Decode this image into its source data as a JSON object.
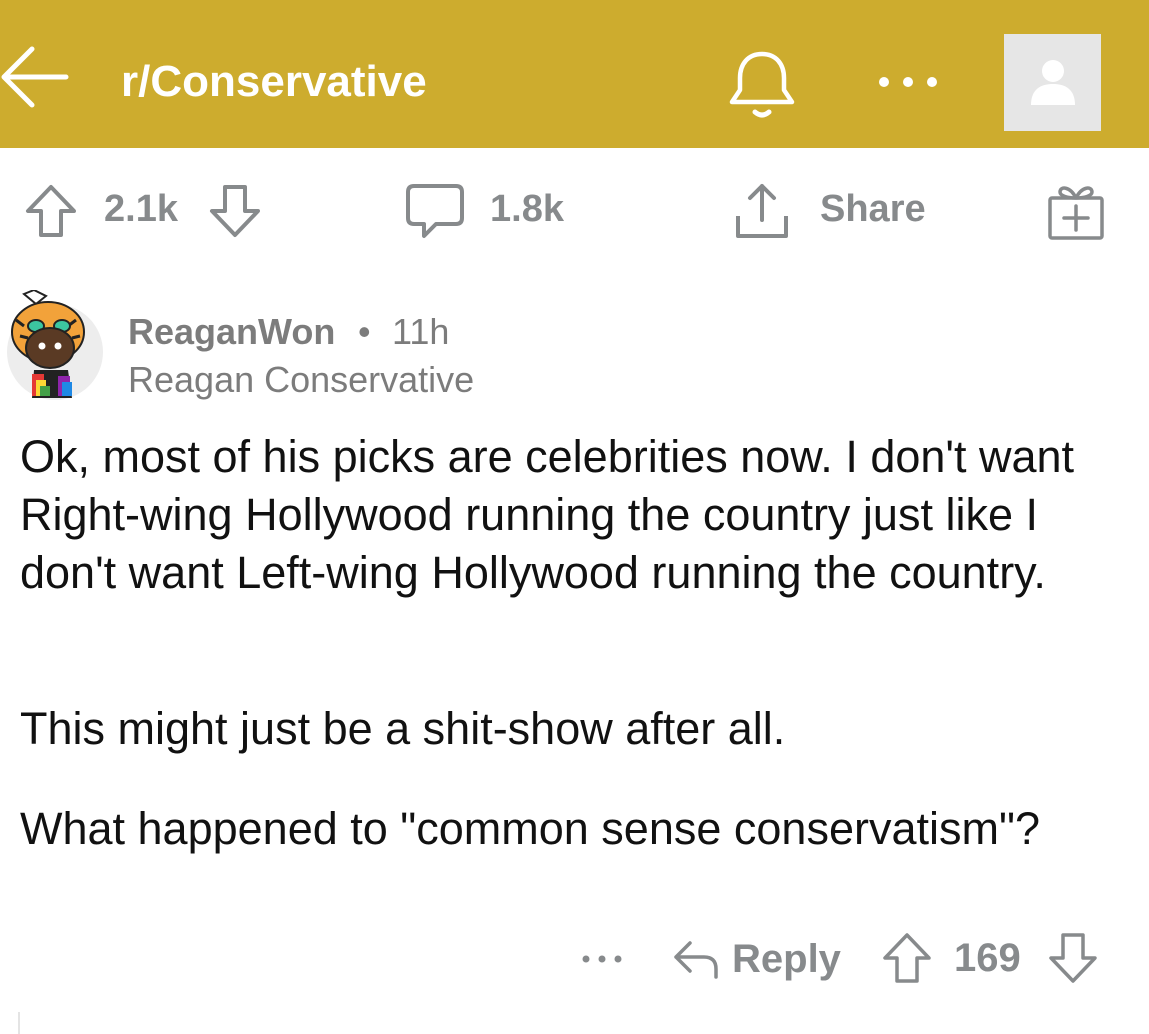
{
  "header": {
    "title": "r/Conservative",
    "back_icon": "arrow-left-icon",
    "bell_icon": "bell-icon",
    "more_icon": "ellipsis-icon",
    "avatar_icon": "user-silhouette-icon",
    "background_color": "#cdac2e"
  },
  "post_actions": {
    "score": "2.1k",
    "comment_count": "1.8k",
    "share_label": "Share",
    "gift_icon": "gift-add-icon"
  },
  "comment": {
    "username": "ReaganWon",
    "separator": "•",
    "time": "11h",
    "flair": "Reagan Conservative",
    "paragraphs": [
      "Ok, most of his picks are celebrities now.  I don't want Right-wing Hollywood running the country just like I don't want Left-wing Hollywood running the country.",
      "This might just be a shit-show after all.",
      "What happened to \"common sense conservatism\"?"
    ],
    "reply_label": "Reply",
    "score": "169"
  },
  "colors": {
    "meta_gray": "#878a8c",
    "text": "#111111"
  }
}
